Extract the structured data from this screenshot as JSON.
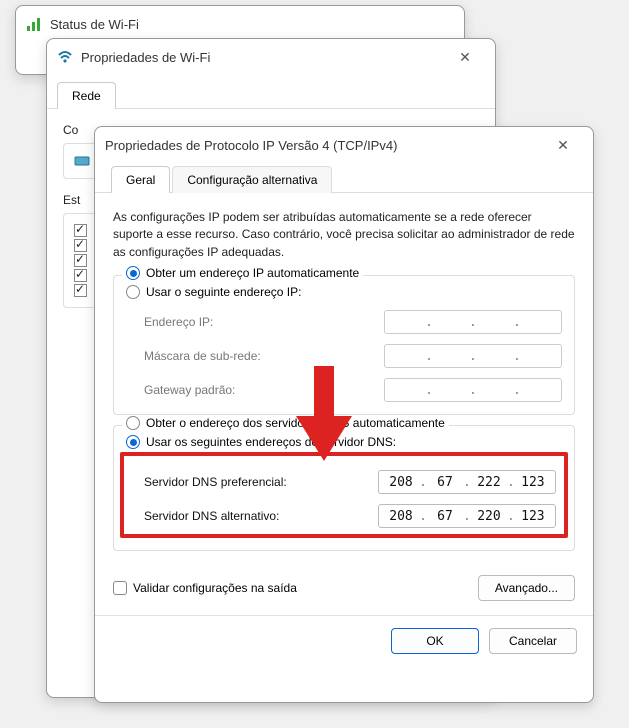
{
  "win1": {
    "title": "Status de Wi-Fi"
  },
  "win2": {
    "title": "Propriedades de Wi-Fi",
    "tab": "Rede",
    "connect_label_partial": "Co",
    "est_label_partial": "Est"
  },
  "win3": {
    "title": "Propriedades de Protocolo IP Versão 4 (TCP/IPv4)",
    "tabs": {
      "general": "Geral",
      "alt": "Configuração alternativa"
    },
    "desc": "As configurações IP podem ser atribuídas automaticamente se a rede oferecer suporte a esse recurso. Caso contrário, você precisa solicitar ao administrador de rede as configurações IP adequadas.",
    "ip_auto": "Obter um endereço IP automaticamente",
    "ip_manual": "Usar o seguinte endereço IP:",
    "ip_fields": {
      "addr": "Endereço IP:",
      "mask": "Máscara de sub-rede:",
      "gw": "Gateway padrão:"
    },
    "dns_auto": "Obter o endereço dos servidores DNS automaticamente",
    "dns_manual": "Usar os seguintes endereços de servidor DNS:",
    "dns_pref_label": "Servidor DNS preferencial:",
    "dns_alt_label": "Servidor DNS alternativo:",
    "dns_pref": [
      "208",
      "67",
      "222",
      "123"
    ],
    "dns_alt": [
      "208",
      "67",
      "220",
      "123"
    ],
    "validate": "Validar configurações na saída",
    "advanced": "Avançado...",
    "ok": "OK",
    "cancel": "Cancelar"
  }
}
